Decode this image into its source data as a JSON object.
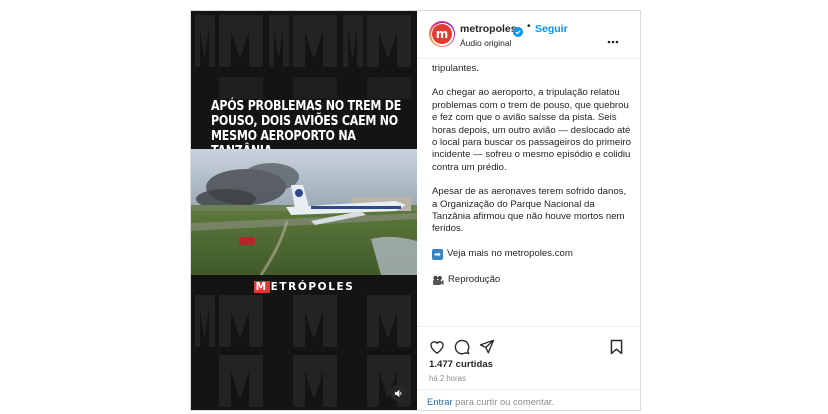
{
  "media": {
    "headline": "Após problemas no trem de pouso, dois aviões caem no mesmo aeroporto na Tanzânia",
    "brand_first": "M",
    "brand_rest": "ETRÓPOLES"
  },
  "header": {
    "username": "metropoles",
    "separator": "•",
    "follow_label": "Seguir",
    "audio_label": "Áudio original",
    "avatar_letter": "m"
  },
  "caption": {
    "cut_line": "tripulantes.",
    "paragraph_1": "Ao chegar ao aeroporto, a tripulação relatou problemas com o trem de pouso, que quebrou e fez com que o avião saísse da pista. Seis horas depois, um outro avião — deslocado até o local para buscar os passageiros do primeiro incidente — sofreu o mesmo episódio e colidiu contra um prédio.",
    "paragraph_2": "Apesar de as aeronaves terem sofrido danos, a Organização do Parque Nacional da Tanzânia afirmou que não houve mortos nem feridos.",
    "link_text": "Veja mais no metropoles.com",
    "credit_text": "Reprodução"
  },
  "stats": {
    "likes": "1.477 curtidas",
    "time": "há 2 horas"
  },
  "comment": {
    "login": "Entrar",
    "rest": "para curtir ou comentar."
  },
  "colors": {
    "brand_red": "#e03a2f",
    "link_blue": "#0095f6",
    "media_bg": "#141414"
  }
}
